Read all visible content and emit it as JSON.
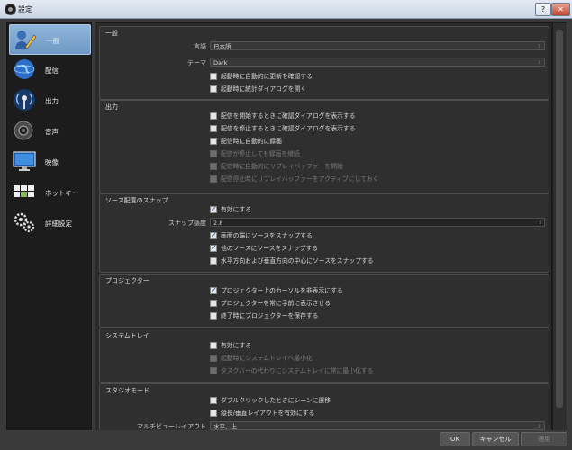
{
  "window": {
    "title": "設定",
    "help_label": "?",
    "close_label": "✕"
  },
  "sidebar": {
    "items": [
      {
        "label": "一般",
        "icon": "user-with-pen-icon",
        "selected": true
      },
      {
        "label": "配信",
        "icon": "globe-icon"
      },
      {
        "label": "出力",
        "icon": "broadcast-icon"
      },
      {
        "label": "音声",
        "icon": "speaker-icon"
      },
      {
        "label": "映像",
        "icon": "monitor-icon"
      },
      {
        "label": "ホットキー",
        "icon": "keyboard-icon"
      },
      {
        "label": "詳細設定",
        "icon": "gears-icon"
      }
    ]
  },
  "general": {
    "title": "一般",
    "language_label": "言語",
    "language_value": "日本語",
    "theme_label": "テーマ",
    "theme_value": "Dark",
    "check_updates": "起動時に自動的に更新を確認する",
    "open_stats": "起動時に統計ダイアログを開く"
  },
  "output": {
    "title": "出力",
    "confirm_start": "配信を開始するときに確認ダイアログを表示する",
    "confirm_stop": "配信を停止するときに確認ダイアログを表示する",
    "auto_record": "配信時に自動的に録画",
    "keep_record": "配信が停止しても録画を継続",
    "auto_replay": "配信時に自動的にリプレイバッファーを開始",
    "keep_replay": "配信停止時にリプレイバッファーをアクティブにしておく"
  },
  "snapping": {
    "title": "ソース配置のスナップ",
    "enable": "有効にする",
    "sensitivity_label": "スナップ感度",
    "sensitivity_value": "2.8",
    "screen_edges": "画面の端にソースをスナップする",
    "other_sources": "他のソースにソースをスナップする",
    "center": "水平方向および垂直方向の中心にソースをスナップする"
  },
  "projectors": {
    "title": "プロジェクター",
    "hide_cursor": "プロジェクター上のカーソルを非表示にする",
    "always_on_top": "プロジェクターを常に手前に表示させる",
    "save_on_exit": "終了時にプロジェクターを保存する"
  },
  "tray": {
    "title": "システムトレイ",
    "enable": "有効にする",
    "minimize_start": "起動時にシステムトレイへ最小化",
    "minimize_instead": "タスクバーの代わりにシステムトレイに常に最小化する"
  },
  "studio": {
    "title": "スタジオモード",
    "double_click": "ダブルクリックしたときにシーンに遷移",
    "portrait_layout": "縦長/垂直レイアウトを有効にする",
    "multiview_label": "マルチビューレイアウト",
    "multiview_value": "水平、上"
  },
  "footer": {
    "ok": "OK",
    "cancel": "キャンセル",
    "apply": "適用"
  }
}
